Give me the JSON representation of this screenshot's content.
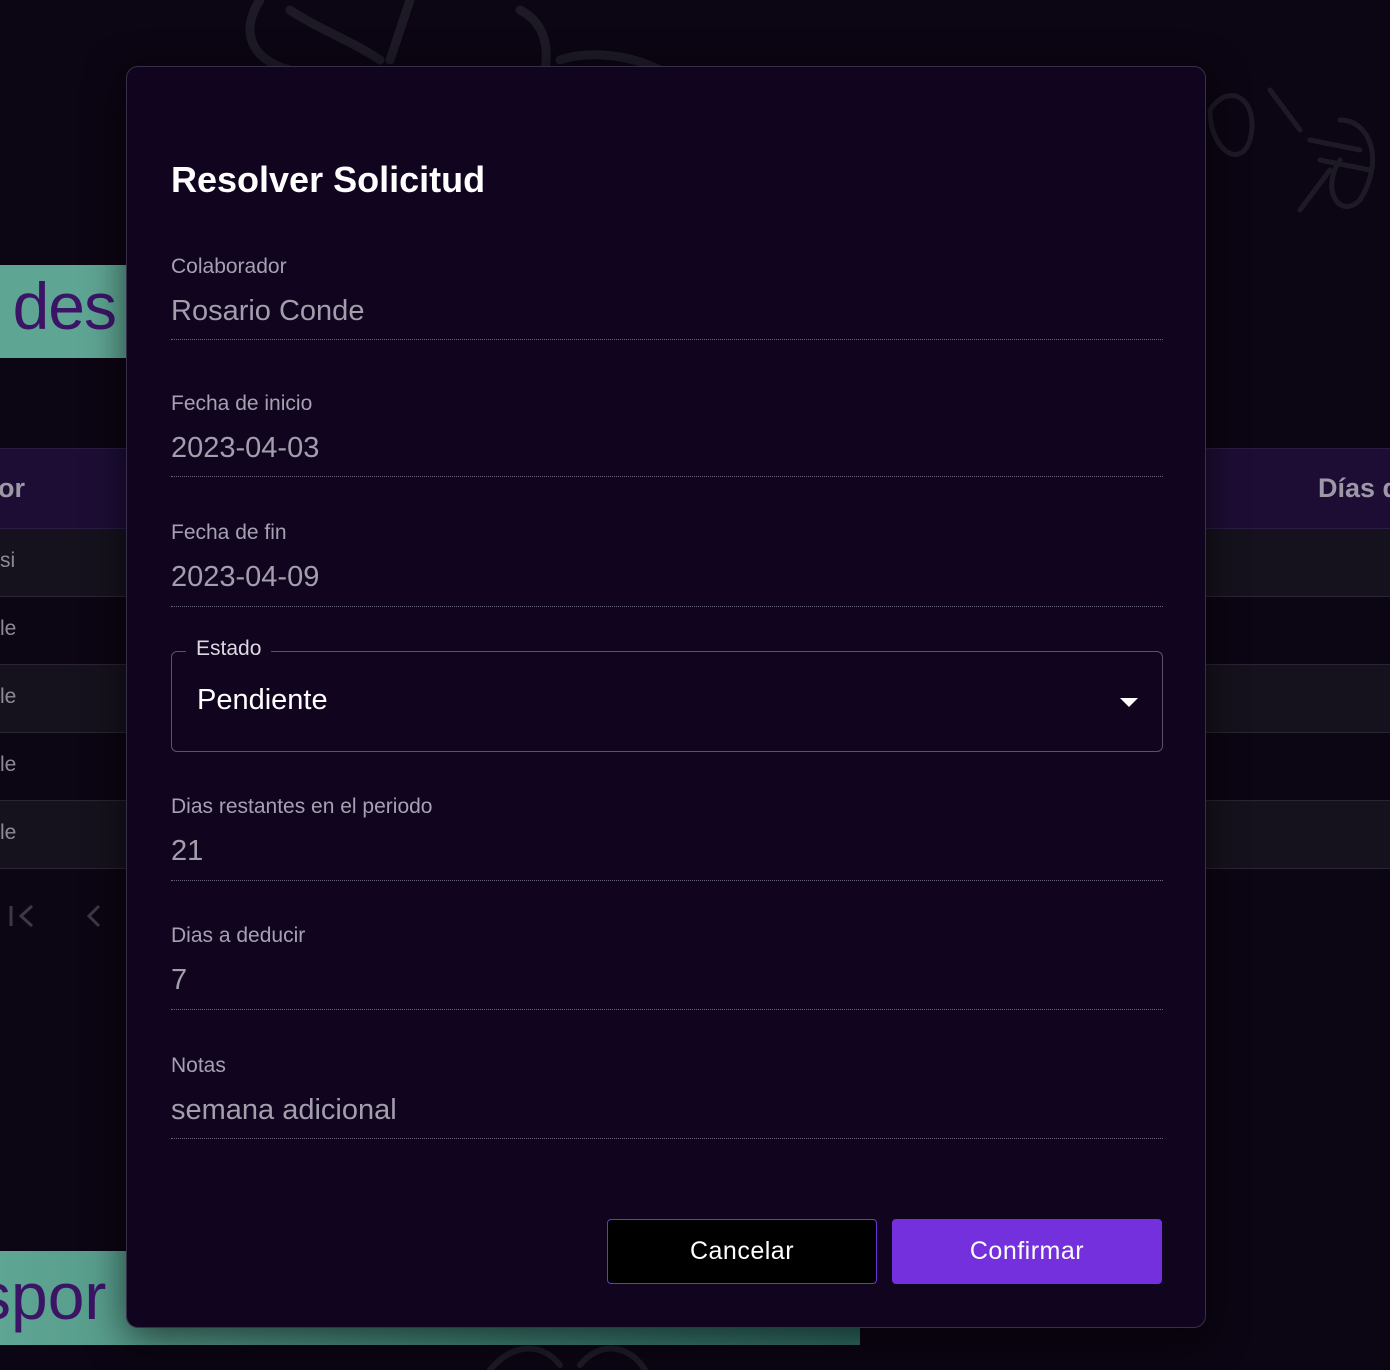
{
  "background": {
    "banner_top_text": "des",
    "banner_bottom_text": "spor",
    "table_header_left": "or",
    "table_header_right": "Días d",
    "rows": [
      "si",
      "le",
      "le",
      "le",
      "le"
    ],
    "colors": {
      "banner": "#5fa593",
      "banner_text": "#3c1466",
      "header": "#1d0d35"
    }
  },
  "dialog": {
    "title": "Resolver Solicitud",
    "fields": {
      "colaborador": {
        "label": "Colaborador",
        "value": "Rosario Conde"
      },
      "fecha_inicio": {
        "label": "Fecha de inicio",
        "value": "2023-04-03"
      },
      "fecha_fin": {
        "label": "Fecha de fin",
        "value": "2023-04-09"
      },
      "estado": {
        "label": "Estado",
        "value": "Pendiente"
      },
      "dias_restantes": {
        "label": "Dias restantes en el periodo",
        "value": "21"
      },
      "dias_deducir": {
        "label": "Dias a deducir",
        "value": "7"
      },
      "notas": {
        "label": "Notas",
        "value": "semana adicional"
      }
    },
    "buttons": {
      "cancel": "Cancelar",
      "confirm": "Confirmar"
    },
    "colors": {
      "primary": "#7430dc",
      "surface": "#10041f"
    }
  },
  "icons": {
    "first_page": "first-page-icon",
    "prev_page": "chevron-left-icon",
    "dropdown": "caret-down-icon"
  }
}
